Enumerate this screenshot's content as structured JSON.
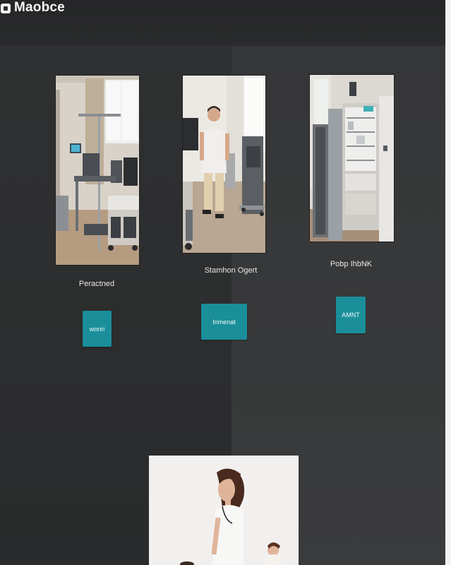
{
  "header": {
    "logo_text": "Maobce",
    "logo_icon": "logo-icon"
  },
  "cards": [
    {
      "image_label": "hospital-room-image",
      "title": "Peractned",
      "button_label": "wonri"
    },
    {
      "image_label": "nurse-walking-image",
      "title": "Stamhon Ogert",
      "button_label": "Inmenat"
    },
    {
      "image_label": "medical-cabinet-image",
      "title": "Pobp IhbNK",
      "button_label": "AMNT"
    }
  ],
  "featured": {
    "image_label": "nurse-profile-image"
  },
  "colors": {
    "accent": "#1a8f9a",
    "background": "#2b2c2e",
    "panel_right": "#3a3b3c"
  }
}
